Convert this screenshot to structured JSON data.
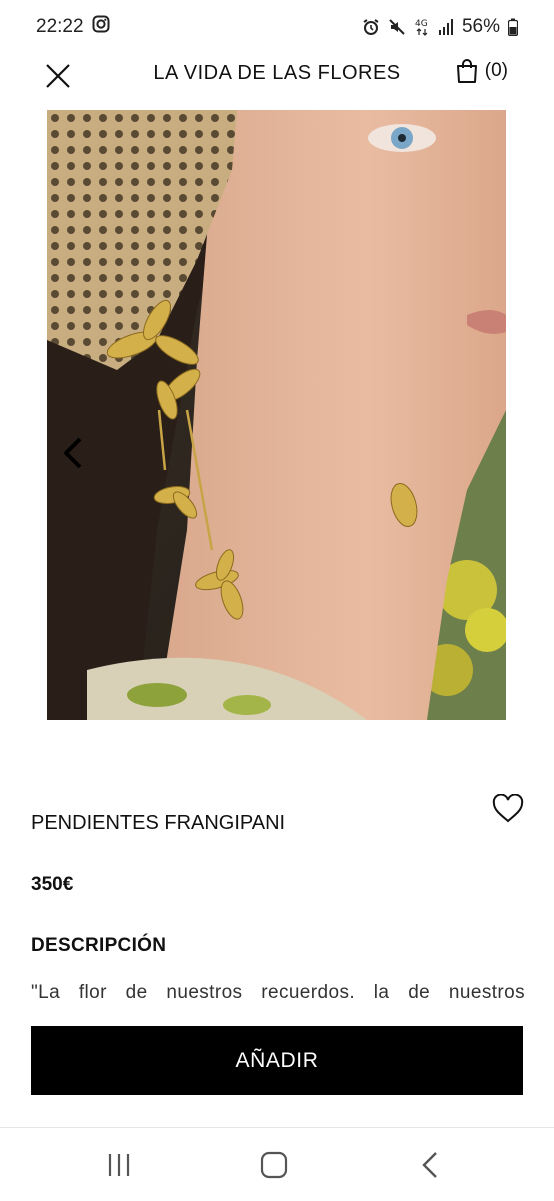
{
  "status_bar": {
    "time": "22:22",
    "battery": "56%",
    "icons": [
      "instagram-icon",
      "alarm-icon",
      "mute-icon",
      "4g-icon",
      "signal-icon",
      "battery-icon"
    ]
  },
  "header": {
    "title": "LA VIDA DE LAS FLORES",
    "cart_count": "(0)",
    "icons": [
      "close-icon",
      "shopping-bag-icon"
    ]
  },
  "product": {
    "name": "PENDIENTES FRANGIPANI",
    "price": "350€",
    "description_heading": "DESCRIPCIÓN",
    "description_excerpt": "\"La flor de nuestros recuerdos, la de nuestros",
    "add_button_label": "AÑADIR"
  },
  "icons": [
    "chevron-left-icon",
    "heart-outline-icon",
    "recent-apps-icon",
    "home-icon",
    "back-icon"
  ],
  "colors": {
    "button_bg": "#000000",
    "button_text": "#ffffff",
    "text": "#111111"
  }
}
